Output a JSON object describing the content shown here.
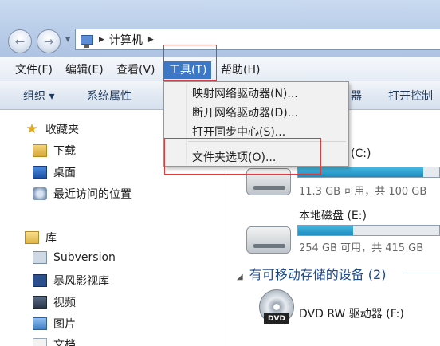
{
  "address": {
    "crumb": "计算机"
  },
  "menubar": [
    {
      "label": "文件(F)",
      "name": "menu-file"
    },
    {
      "label": "编辑(E)",
      "name": "menu-edit"
    },
    {
      "label": "查看(V)",
      "name": "menu-view"
    },
    {
      "label": "工具(T)",
      "name": "menu-tools",
      "active": true
    },
    {
      "label": "帮助(H)",
      "name": "menu-help"
    }
  ],
  "toolbar": {
    "organize": "组织 ▾",
    "system_properties": "系统属性",
    "partial": "器",
    "open_control": "打开控制"
  },
  "tools_menu": [
    {
      "label": "映射网络驱动器(N)..."
    },
    {
      "label": "断开网络驱动器(D)..."
    },
    {
      "label": "打开同步中心(S)..."
    },
    {
      "label": "文件夹选项(O)..."
    }
  ],
  "sidebar": {
    "favorites": "收藏夹",
    "downloads": "下载",
    "desktop": "桌面",
    "recent": "最近访问的位置",
    "libraries": "库",
    "subversion": "Subversion",
    "storm": "暴风影视库",
    "videos": "视频",
    "pictures": "图片",
    "documents": "文档"
  },
  "drives": {
    "c_label": "(C:)",
    "c_space": "11.3 GB 可用，共 100 GB",
    "c_used_fraction": 0.887,
    "e_label": "本地磁盘 (E:)",
    "e_space": "254 GB 可用，共 415 GB",
    "e_used_fraction": 0.388,
    "removable_header": "有可移动存储的设备 (2)",
    "dvd_label": "DVD RW 驱动器 (F:)",
    "dvd_badge": "DVD"
  },
  "colors": {
    "menu_active": "#3d78c7",
    "highlight_box": "#e23a3a",
    "drive_bar": "#1c8bc0"
  }
}
